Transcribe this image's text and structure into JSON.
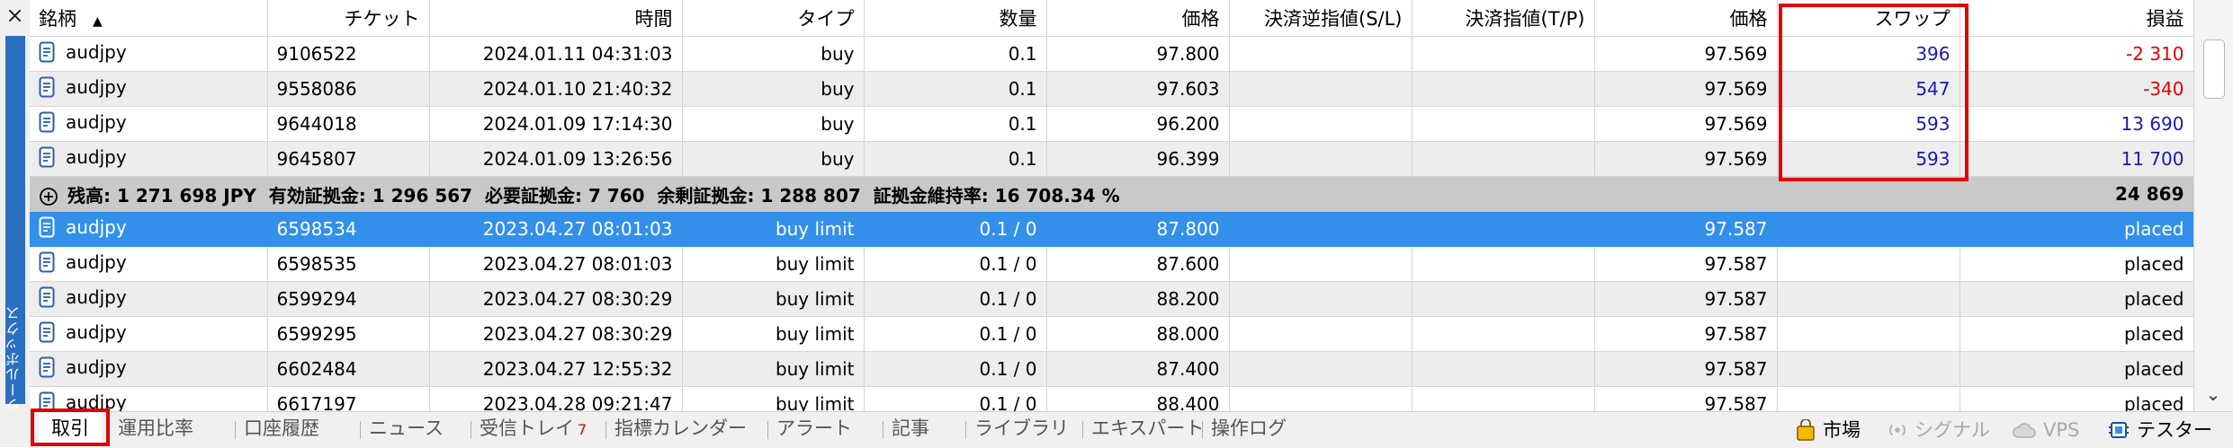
{
  "toolbox": {
    "close_label": "×",
    "vertical_label": "ツールボックス"
  },
  "columns": [
    "銘柄",
    "チケット",
    "時間",
    "タイプ",
    "数量",
    "価格",
    "決済逆指値(S/L)",
    "決済指値(T/P)",
    "価格",
    "スワップ",
    "損益"
  ],
  "sort_indicator": "▲",
  "positions": [
    {
      "symbol": "audjpy",
      "ticket": "9106522",
      "time": "2024.01.11 04:31:03",
      "type": "buy",
      "volume": "0.1",
      "price": "97.800",
      "sl": "",
      "tp": "",
      "cur_price": "97.569",
      "swap": "396",
      "profit": "-2 310",
      "profit_sign": "neg"
    },
    {
      "symbol": "audjpy",
      "ticket": "9558086",
      "time": "2024.01.10 21:40:32",
      "type": "buy",
      "volume": "0.1",
      "price": "97.603",
      "sl": "",
      "tp": "",
      "cur_price": "97.569",
      "swap": "547",
      "profit": "-340",
      "profit_sign": "neg"
    },
    {
      "symbol": "audjpy",
      "ticket": "9644018",
      "time": "2024.01.09 17:14:30",
      "type": "buy",
      "volume": "0.1",
      "price": "96.200",
      "sl": "",
      "tp": "",
      "cur_price": "97.569",
      "swap": "593",
      "profit": "13 690",
      "profit_sign": "pos"
    },
    {
      "symbol": "audjpy",
      "ticket": "9645807",
      "time": "2024.01.09 13:26:56",
      "type": "buy",
      "volume": "0.1",
      "price": "96.399",
      "sl": "",
      "tp": "",
      "cur_price": "97.569",
      "swap": "593",
      "profit": "11 700",
      "profit_sign": "pos"
    }
  ],
  "summary": {
    "text": "残高: 1 271 698 JPY  有効証拠金: 1 296 567  必要証拠金: 7 760  余剰証拠金: 1 288 807  証拠金維持率: 16 708.34 %",
    "total": "24 869"
  },
  "orders": [
    {
      "symbol": "audjpy",
      "ticket": "6598534",
      "time": "2023.04.27 08:01:03",
      "type": "buy limit",
      "volume": "0.1 / 0",
      "price": "87.800",
      "cur_price": "97.587",
      "status": "placed",
      "selected": true
    },
    {
      "symbol": "audjpy",
      "ticket": "6598535",
      "time": "2023.04.27 08:01:03",
      "type": "buy limit",
      "volume": "0.1 / 0",
      "price": "87.600",
      "cur_price": "97.587",
      "status": "placed"
    },
    {
      "symbol": "audjpy",
      "ticket": "6599294",
      "time": "2023.04.27 08:30:29",
      "type": "buy limit",
      "volume": "0.1 / 0",
      "price": "88.200",
      "cur_price": "97.587",
      "status": "placed"
    },
    {
      "symbol": "audjpy",
      "ticket": "6599295",
      "time": "2023.04.27 08:30:29",
      "type": "buy limit",
      "volume": "0.1 / 0",
      "price": "88.000",
      "cur_price": "97.587",
      "status": "placed"
    },
    {
      "symbol": "audjpy",
      "ticket": "6602484",
      "time": "2023.04.27 12:55:32",
      "type": "buy limit",
      "volume": "0.1 / 0",
      "price": "87.400",
      "cur_price": "97.587",
      "status": "placed"
    },
    {
      "symbol": "audjpy",
      "ticket": "6617197",
      "time": "2023.04.28 09:21:47",
      "type": "buy limit",
      "volume": "0.1 / 0",
      "price": "88.400",
      "cur_price": "97.587",
      "status": "placed"
    }
  ],
  "tabs": [
    {
      "label": "取引",
      "active": true
    },
    {
      "label": "運用比率"
    },
    {
      "label": "口座履歴"
    },
    {
      "label": "ニュース"
    },
    {
      "label": "受信トレイ",
      "badge": "7"
    },
    {
      "label": "指標カレンダー"
    },
    {
      "label": "アラート"
    },
    {
      "label": "記事"
    },
    {
      "label": "ライブラリ"
    },
    {
      "label": "エキスパート"
    },
    {
      "label": "操作ログ"
    }
  ],
  "right_tabs": [
    {
      "label": "市場",
      "icon": "shopping-bag-icon"
    },
    {
      "label": "シグナル",
      "icon": "signal-icon",
      "dim": true
    },
    {
      "label": "VPS",
      "icon": "cloud-icon",
      "dim": true
    },
    {
      "label": "テスター",
      "icon": "tester-icon"
    }
  ],
  "colors": {
    "selected_row": "#3390ea",
    "summary_row": "#c9c9c9",
    "highlight_box": "#e00000",
    "negative": "#e00000",
    "positive": "#1a1ab0"
  }
}
